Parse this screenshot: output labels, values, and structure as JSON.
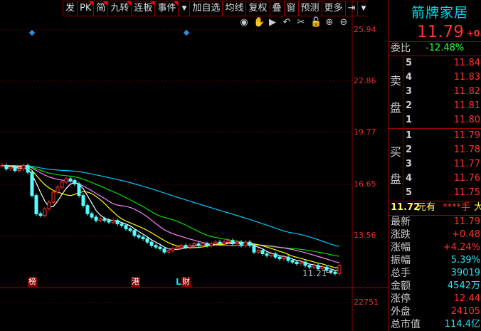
{
  "toolbar": {
    "items": [
      {
        "label": "发",
        "flag": false
      },
      {
        "label": "PK",
        "flag": true
      },
      {
        "label": "简",
        "flag": true
      },
      {
        "label": "九转",
        "flag": true
      },
      {
        "label": "连板",
        "flag": true
      },
      {
        "label": "事件",
        "flag": true
      },
      {
        "label": "▼",
        "flag": false
      },
      {
        "label": "加自选",
        "flag": false
      },
      {
        "label": "均线",
        "flag": false
      },
      {
        "label": "复权",
        "flag": false
      },
      {
        "label": "叠",
        "flag": false
      },
      {
        "label": "窗",
        "flag": false
      },
      {
        "label": "预测",
        "flag": false
      },
      {
        "label": "更多",
        "flag": false
      },
      {
        "label": "⇥",
        "flag": false
      },
      {
        "label": "▼",
        "flag": false
      }
    ]
  },
  "tools": [
    {
      "icon": "eye-icon",
      "glyph": "◉"
    },
    {
      "icon": "hand-icon",
      "glyph": "✋"
    },
    {
      "icon": "play-icon",
      "glyph": "▶"
    },
    {
      "icon": "undo-icon",
      "glyph": "↶"
    },
    {
      "icon": "scissors-icon",
      "glyph": "✂"
    },
    {
      "icon": "lock-icon",
      "glyph": "🔓"
    },
    {
      "icon": "zoom-in-icon",
      "glyph": "⊕"
    },
    {
      "icon": "zoom-out-icon",
      "glyph": "⊖"
    }
  ],
  "price_axis": [
    "25.94",
    "22.86",
    "19.77",
    "16.65",
    "13.56"
  ],
  "volume_axis": "22751",
  "low_label": "11.21",
  "markers": [
    {
      "label": "榜"
    },
    {
      "label": "港"
    },
    {
      "label": "财",
      "prefix": "L"
    }
  ],
  "colors": {
    "up": "#ff3232",
    "down": "#54ffff",
    "ma5": "#ffffff",
    "ma10": "#ffff00",
    "ma20": "#ff80ff",
    "ma30": "#00e000",
    "ma60": "#00c8ff"
  },
  "chart_data": {
    "type": "candlestick",
    "closes": [
      17.8,
      17.6,
      17.7,
      17.5,
      17.6,
      17.8,
      17.4,
      16.0,
      14.9,
      14.8,
      15.2,
      15.6,
      16.2,
      16.5,
      16.8,
      17.0,
      16.9,
      16.7,
      16.0,
      15.4,
      14.9,
      14.7,
      14.5,
      14.6,
      14.5,
      14.4,
      14.5,
      14.3,
      14.2,
      14.0,
      13.9,
      13.6,
      13.5,
      13.4,
      13.2,
      13.0,
      12.9,
      12.8,
      12.6,
      12.7,
      12.8,
      12.9,
      13.0,
      12.9,
      13.0,
      13.1,
      13.0,
      13.1,
      13.0,
      13.1,
      13.2,
      13.1,
      13.2,
      13.3,
      13.1,
      13.2,
      13.0,
      13.2,
      13.0,
      12.6,
      12.7,
      12.5,
      12.4,
      12.5,
      12.3,
      12.2,
      12.3,
      12.1,
      12.0,
      11.9,
      12.0,
      11.8,
      11.7,
      11.8,
      11.6,
      11.7,
      11.5,
      11.4,
      11.31,
      11.79
    ]
  },
  "quote": {
    "name": "箭牌家居",
    "price": "11.79",
    "change_short": "+0.",
    "weibi_label": "委比",
    "weibi": "-12.48%",
    "sell_label": [
      "卖",
      "盘"
    ],
    "buy_label": [
      "买",
      "盘"
    ],
    "sell": [
      {
        "lvl": "5",
        "p": "11.84"
      },
      {
        "lvl": "4",
        "p": "11.83"
      },
      {
        "lvl": "3",
        "p": "11.82"
      },
      {
        "lvl": "2",
        "p": "11.81"
      },
      {
        "lvl": "1",
        "p": "11.80"
      }
    ],
    "buy": [
      {
        "lvl": "1",
        "p": "11.79"
      },
      {
        "lvl": "2",
        "p": "11.78"
      },
      {
        "lvl": "3",
        "p": "11.77"
      },
      {
        "lvl": "4",
        "p": "11.76"
      },
      {
        "lvl": "5",
        "p": "11.75"
      }
    ],
    "big_order": {
      "price": "11.72",
      "unit": "元有",
      "qty": "****手",
      "tail": "大"
    },
    "stats": [
      {
        "label": "最新",
        "value": "11.79",
        "color": "#ff3030"
      },
      {
        "label": "涨跌",
        "value": "+0.48",
        "color": "#ff3030"
      },
      {
        "label": "涨幅",
        "value": "+4.24%",
        "color": "#ff3030"
      },
      {
        "label": "振幅",
        "value": "5.39%",
        "color": "#30e0f0"
      },
      {
        "label": "总手",
        "value": "39019",
        "color": "#30e0f0"
      },
      {
        "label": "金额",
        "value": "4542万",
        "color": "#30e0f0"
      },
      {
        "label": "涨停",
        "value": "12.44",
        "color": "#ff3030"
      },
      {
        "label": "外盘",
        "value": "24105",
        "color": "#ff3030"
      },
      {
        "label": "总市值",
        "value": "114.4亿",
        "color": "#30e0f0"
      }
    ]
  }
}
